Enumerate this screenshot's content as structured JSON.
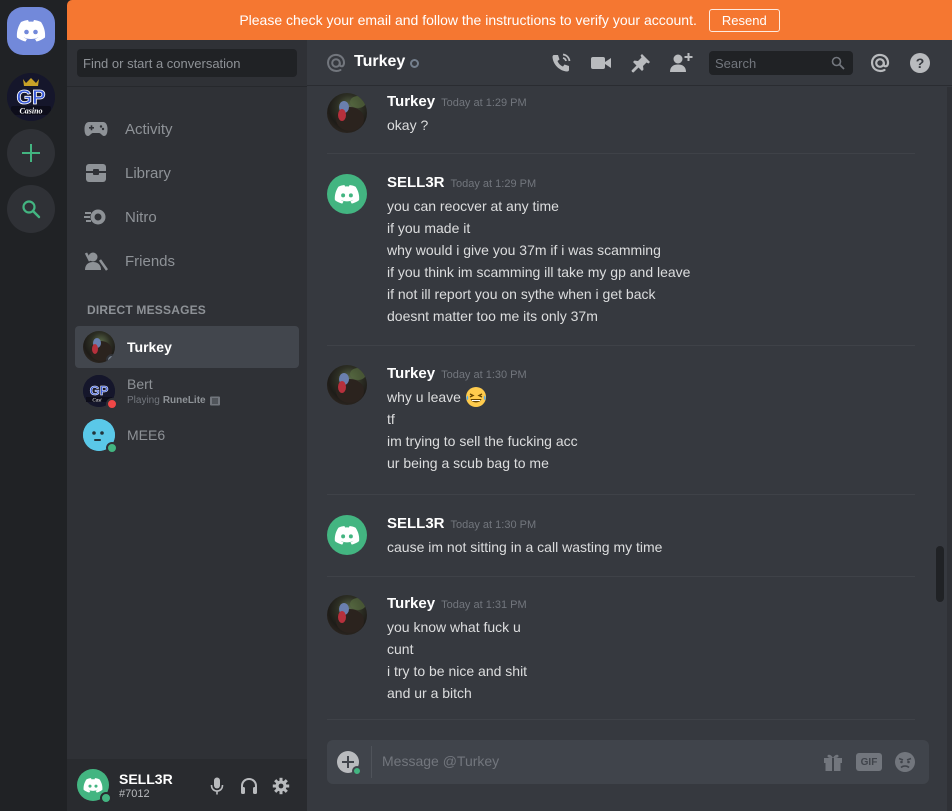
{
  "banner": {
    "message": "Please check your email and follow the instructions to verify your account.",
    "button": "Resend"
  },
  "sidebar": {
    "search_placeholder": "Find or start a conversation",
    "nav": [
      {
        "label": "Activity",
        "icon": "controller-icon"
      },
      {
        "label": "Library",
        "icon": "library-icon"
      },
      {
        "label": "Nitro",
        "icon": "nitro-icon"
      },
      {
        "label": "Friends",
        "icon": "friends-icon"
      }
    ],
    "dm_header": "DIRECT MESSAGES",
    "dms": [
      {
        "name": "Turkey",
        "status": "offline",
        "active": true
      },
      {
        "name": "Bert",
        "status": "dnd",
        "activity_prefix": "Playing",
        "activity_game": "RuneLite"
      },
      {
        "name": "MEE6",
        "status": "online"
      }
    ]
  },
  "user": {
    "name": "SELL3R",
    "tag": "#7012"
  },
  "channel": {
    "name": "Turkey",
    "search_placeholder": "Search"
  },
  "messages": [
    {
      "author": "Turkey",
      "time": "Today at 1:29 PM",
      "lines": [
        "okay ?"
      ]
    },
    {
      "author": "SELL3R",
      "time": "Today at 1:29 PM",
      "lines": [
        "you can reocver at any time",
        "if you made it",
        "why would i give you 37m if i was scamming",
        "if you think im scamming ill take my gp and leave",
        "if not ill report you on sythe when i get back",
        "doesnt matter too me its only 37m"
      ]
    },
    {
      "author": "Turkey",
      "time": "Today at 1:30 PM",
      "lines": [
        "why u leave",
        "tf",
        "im trying to sell the fucking acc",
        "ur being a scub bag to me"
      ]
    },
    {
      "author": "SELL3R",
      "time": "Today at 1:30 PM",
      "lines": [
        "cause im not sitting in a call wasting my time"
      ]
    },
    {
      "author": "Turkey",
      "time": "Today at 1:31 PM",
      "lines": [
        "you know what fuck u",
        "cunt",
        "i try to be nice and shit",
        "and ur a bitch"
      ]
    }
  ],
  "composer": {
    "placeholder": "Message @Turkey",
    "gif_label": "GIF"
  },
  "colors": {
    "blurple": "#7289da",
    "banner": "#f57731",
    "online": "#43b581",
    "dnd": "#f04747",
    "offline": "#747f8d"
  }
}
